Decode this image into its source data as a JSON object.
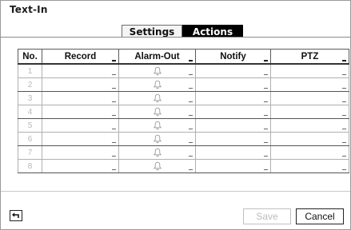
{
  "window": {
    "title": "Text-In"
  },
  "tabs": [
    {
      "label": "Settings",
      "active": false
    },
    {
      "label": "Actions",
      "active": true
    }
  ],
  "table": {
    "columns": [
      "No.",
      "Record",
      "Alarm-Out",
      "Notify",
      "PTZ"
    ],
    "rows": [
      {
        "no": "1",
        "alarm_icon": "bell-icon"
      },
      {
        "no": "2",
        "alarm_icon": "bell-icon"
      },
      {
        "no": "3",
        "alarm_icon": "bell-icon"
      },
      {
        "no": "4",
        "alarm_icon": "bell-icon"
      },
      {
        "no": "5",
        "alarm_icon": "bell-icon"
      },
      {
        "no": "6",
        "alarm_icon": "bell-icon"
      },
      {
        "no": "7",
        "alarm_icon": "bell-icon"
      },
      {
        "no": "8",
        "alarm_icon": "bell-icon"
      }
    ]
  },
  "footer": {
    "back_icon": "back-arrow-icon",
    "save_label": "Save",
    "save_enabled": false,
    "cancel_label": "Cancel"
  },
  "colors": {
    "active_tab_bg": "#000000",
    "disabled_text": "#bcbcbc"
  }
}
